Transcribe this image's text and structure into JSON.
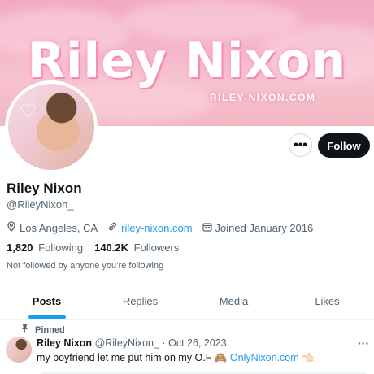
{
  "banner": {
    "title": "Riley Nixon",
    "subtitle": "RILEY-NIXON.COM"
  },
  "profile": {
    "name": "Riley Nixon",
    "handle": "@RileyNixon_",
    "location": "Los Angeles, CA",
    "website": "riley-nixon.com",
    "joined": "Joined January 2016",
    "following_count": "1,820",
    "following_label": "Following",
    "followers_count": "140.2K",
    "followers_label": "Followers",
    "not_followed": "Not followed by anyone you’re following"
  },
  "actions": {
    "more": "•••",
    "follow": "Follow"
  },
  "tabs": [
    {
      "label": "Posts"
    },
    {
      "label": "Replies"
    },
    {
      "label": "Media"
    },
    {
      "label": "Likes"
    }
  ],
  "tweet": {
    "pinned_label": "Pinned",
    "name": "Riley Nixon",
    "handle": "@RileyNixon_",
    "separator": "·",
    "date": "Oct 26, 2023",
    "text": "my boyfriend let me put him on my O.F",
    "emoji": "🙈",
    "link": "OnlyNixon.com",
    "emoji2": "👈🏻",
    "more": "···"
  },
  "colors": {
    "accent": "#1d9bf0",
    "text": "#0f1419",
    "muted": "#536471"
  }
}
